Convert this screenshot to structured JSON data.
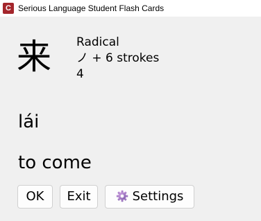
{
  "window": {
    "title": "Serious Language Student Flash Cards",
    "icon_letter": "C",
    "icon_color": "#a4262c"
  },
  "card": {
    "character": "来",
    "info_label": "Radical",
    "radical_strokes": "ノ + 6 strokes",
    "count": "4",
    "pinyin": "lái",
    "meaning": "to come"
  },
  "buttons": {
    "ok_label": "OK",
    "exit_label": "Exit",
    "settings_label": "Settings",
    "settings_icon": "gear-icon"
  }
}
